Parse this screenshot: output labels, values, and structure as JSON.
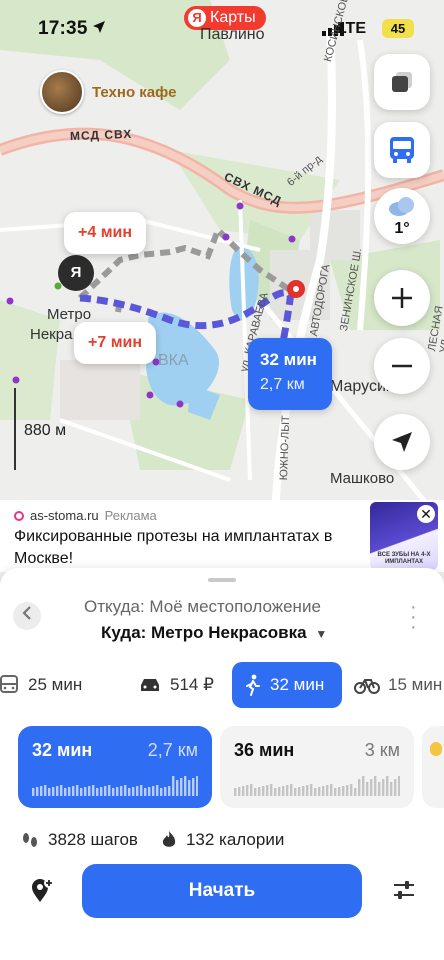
{
  "status": {
    "time": "17:35",
    "network": "LTE",
    "battery": "45"
  },
  "brand": {
    "label": "Карты",
    "logo": "Я"
  },
  "map": {
    "place_pavlino": "Павлино",
    "place_maryino": "Марусино",
    "place_mashkovo": "Машково",
    "lake_label": "ВКА",
    "road_msd_svh_1": "МСД  СВХ",
    "road_svh_msd_2": "СВХ  МСД",
    "road_kosinskoe": "КОСИНСКОЕ Ш.",
    "road_6th": "6-й пр-д",
    "road_zeninskoe": "ЗЕНИНСКОЕ Ш.",
    "road_karavaeva": "ул. КАРАВАЕВА",
    "road_yuzhno": "ЮЖНО-ЛЫТ",
    "road_avtodoroga": "АВТОДОРОГА",
    "road_lesnaya": "ЛЕСНАЯ УЛ",
    "cafe_name": "Техно кафе",
    "metro_name_line1": "Метро",
    "metro_name_line2": "Некра",
    "scale_label": "880 м",
    "alt_route_1": "+4 мин",
    "alt_route_2": "+7 мин",
    "route_time": "32 мин",
    "route_distance": "2,7 км",
    "weather_temp": "1°"
  },
  "ad": {
    "source": "as-stoma.ru",
    "label": "Реклама",
    "text": "Фиксированные протезы на имплантатах в Москве!",
    "thumb_caption": "ВСЕ ЗУБЫ НА 4-Х ИМПЛАНТАХ"
  },
  "sheet": {
    "from": "Откуда: Моё местоположение",
    "to": "Куда: Метро Некрасовка",
    "modes": [
      {
        "icon": "bus-icon",
        "label": "25 мин"
      },
      {
        "icon": "taxi-icon",
        "label": "514 ₽"
      },
      {
        "icon": "walk-icon",
        "label": "32 мин"
      },
      {
        "icon": "bike-icon",
        "label": "15 мин"
      }
    ],
    "options": [
      {
        "time": "32 мин",
        "distance": "2,7 км"
      },
      {
        "time": "36 мин",
        "distance": "3 км"
      }
    ],
    "steps": "3828 шагов",
    "calories": "132 калории",
    "start": "Начать"
  },
  "colors": {
    "accent": "#2f6df2",
    "alt_route": "#e4402d",
    "brand": "#f23a2e"
  }
}
